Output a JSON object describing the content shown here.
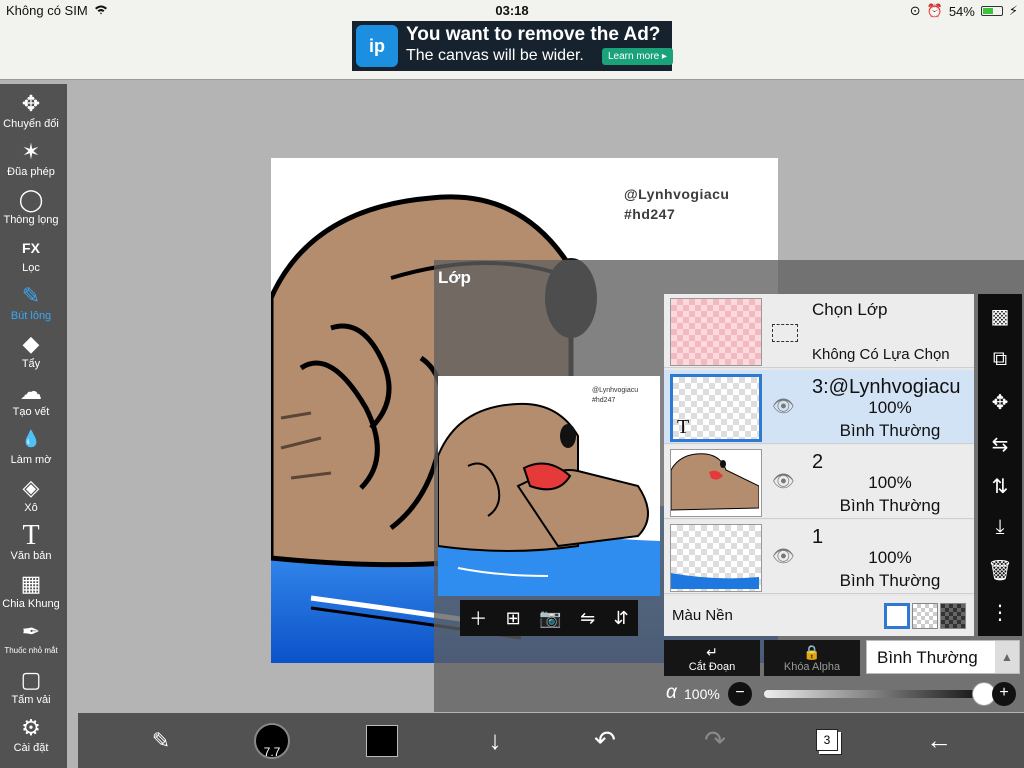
{
  "status": {
    "carrier": "Không có SIM",
    "time": "03:18",
    "battery": "54%",
    "battery_level": 0.54
  },
  "ad": {
    "logo": "ip",
    "headline": "You want to remove the Ad?",
    "sub": "The canvas will be wider.",
    "cta": "Learn more ▸"
  },
  "tools": [
    {
      "label": "Chuyển đổi",
      "icon": "✥"
    },
    {
      "label": "Đũa phép",
      "icon": "✶"
    },
    {
      "label": "Thòng lọng",
      "icon": "◯"
    },
    {
      "label": "Lọc",
      "icon": "FX"
    },
    {
      "label": "Bút lông",
      "icon": "✎"
    },
    {
      "label": "Tẩy",
      "icon": "◆"
    },
    {
      "label": "Tạo vết",
      "icon": "☁"
    },
    {
      "label": "Làm mờ",
      "icon": "💧"
    },
    {
      "label": "Xô",
      "icon": "◈"
    },
    {
      "label": "Văn bản",
      "icon": "T"
    },
    {
      "label": "Chia Khung",
      "icon": "▦"
    },
    {
      "label": "Thuốc nhỏ mắt",
      "icon": "✒"
    },
    {
      "label": "Tấm vải",
      "icon": "▢"
    },
    {
      "label": "Cài đặt",
      "icon": "⚙"
    }
  ],
  "canvas": {
    "watermark_1": "@Lynhvogiacu",
    "watermark_2": "#hd247"
  },
  "layer_panel": {
    "title": "Lớp",
    "selection": {
      "title": "Chọn Lớp",
      "subtitle": "Không Có Lựa Chọn"
    },
    "layers": [
      {
        "name": "3:@Lynhvogiacu",
        "opacity": "100%",
        "mode": "Bình Thường",
        "thumb_mark": "T"
      },
      {
        "name": "2",
        "opacity": "100%",
        "mode": "Bình Thường"
      },
      {
        "name": "1",
        "opacity": "100%",
        "mode": "Bình Thường"
      }
    ],
    "background_label": "Màu Nền",
    "clipping_label": "Cắt Đoạn",
    "alpha_lock_label": "Khóa Alpha",
    "blend_mode": "Bình Thường",
    "alpha_symbol": "α",
    "alpha_value": "100%",
    "alpha_level": 1.0
  },
  "bottombar": {
    "brush_size": "7.7",
    "layer_count": "3"
  },
  "colors": {
    "toolbar": "#525252",
    "active": "#3aa7f2",
    "selected_layer": "#d3e3f6"
  }
}
